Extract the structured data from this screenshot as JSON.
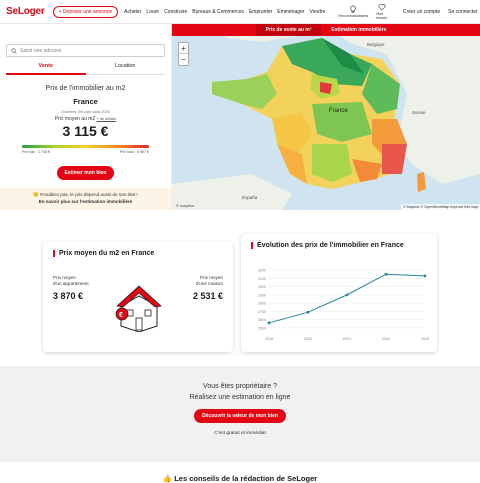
{
  "header": {
    "logo": "SeLoger",
    "depose_label": "+ Déposer une annonce",
    "nav": [
      "Acheter",
      "Louer",
      "Construire",
      "Bureaux & Commerces",
      "Emprunter",
      "Emménager",
      "Vendre"
    ],
    "recommandations": "Recommandations",
    "favoris": "Mes favoris",
    "creer_compte": "Créer un compte",
    "connecter": "Se connecter"
  },
  "left": {
    "search_placeholder": "Saisir une adresse",
    "tab_vente": "Vente",
    "tab_location": "Location",
    "title": "Prix de l'immobilier au m2",
    "region": "France",
    "source": "Données SeLoger août 2025",
    "price_label": "Prix moyen au m2",
    "detail_link": "+ de détails",
    "price": "3 115 €",
    "low": "Prix bas : 1 738 €",
    "high": "Prix haut : 6 987 €",
    "estimer": "Estimer mon bien",
    "tip_line1": "N'oubliez pas, le prix dépend aussi de son état !",
    "tip_line2": "En savoir plus sur l'estimation immobilière"
  },
  "map": {
    "tab_active": "Prix de vente au m²",
    "tab_other": "Estimation immobilière",
    "label_france": "France",
    "label_belgique": "Belgique",
    "label_suisse": "Suisse",
    "label_espana": "España",
    "zoom_in": "+",
    "zoom_out": "−",
    "attribution": "© Mapbox © OpenStreetMap Improve this map",
    "mapbox": "© mapbox"
  },
  "card1": {
    "title": "Prix moyen du m2 en France",
    "apt_label1": "Prix moyen",
    "apt_label2": "d'un appartement",
    "apt_value": "3 870 €",
    "house_label1": "Prix moyen",
    "house_label2": "d'une maison",
    "house_value": "2 531 €"
  },
  "card2": {
    "title": "Évolution des prix de l'immobilier en France"
  },
  "chart_data": {
    "type": "line",
    "x": [
      "2018",
      "2020",
      "2021",
      "2022",
      "2023"
    ],
    "yticks": [
      "2500",
      "2600",
      "2700",
      "2800",
      "2900",
      "3000",
      "3100",
      "3200"
    ],
    "series": [
      {
        "values": [
          2560,
          2690,
          2900,
          3150,
          3130
        ]
      }
    ],
    "ylim": [
      2450,
      3250
    ],
    "grid": true
  },
  "bottom": {
    "q1": "Vous êtes propriétaire ?",
    "q2": "Réalisez une estimation en ligne",
    "decouvrir": "Découvrir la valeur de mon bien",
    "gratuit": "C'est gratuit et immédiat",
    "conseils": "👍 Les conseils de la rédaction de SeLoger"
  },
  "colors": {
    "brand": "#e30513",
    "chart_line": "#1f8a94"
  }
}
